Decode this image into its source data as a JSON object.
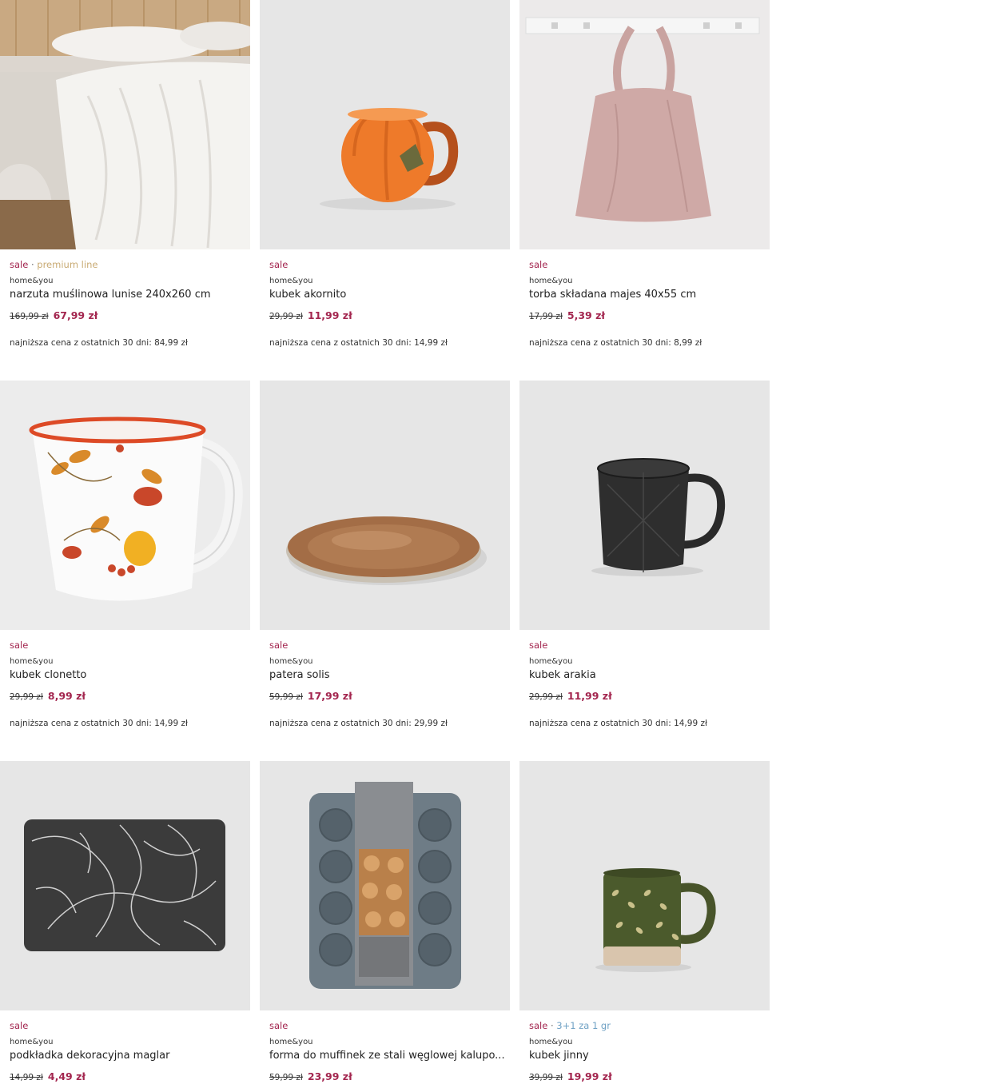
{
  "colors": {
    "sale": "#a3264f",
    "premium": "#c9ab74",
    "promo": "#6fa1c4",
    "image_bg": "#e6e6e6"
  },
  "products": [
    {
      "image": "bedspread-photo",
      "tag_sale": "sale",
      "tag_extra": "premium line",
      "tag_extra_kind": "premium",
      "brand": "home&you",
      "name": "narzuta muślinowa lunise 240x260 cm",
      "old_price": "169,99 zł",
      "new_price": "67,99 zł",
      "lowest": "najniższa cena z ostatnich 30 dni: 84,99 zł"
    },
    {
      "image": "pumpkin-mug-photo",
      "tag_sale": "sale",
      "tag_extra": "",
      "tag_extra_kind": "",
      "brand": "home&you",
      "name": "kubek akornito",
      "old_price": "29,99 zł",
      "new_price": "11,99 zł",
      "lowest": "najniższa cena z ostatnich 30 dni: 14,99 zł"
    },
    {
      "image": "tote-bag-photo",
      "tag_sale": "sale",
      "tag_extra": "",
      "tag_extra_kind": "",
      "brand": "home&you",
      "name": "torba składana majes 40x55 cm",
      "old_price": "17,99 zł",
      "new_price": "5,39 zł",
      "lowest": "najniższa cena z ostatnich 30 dni: 8,99 zł"
    },
    {
      "image": "autumn-mug-photo",
      "tag_sale": "sale",
      "tag_extra": "",
      "tag_extra_kind": "",
      "brand": "home&you",
      "name": "kubek clonetto",
      "old_price": "29,99 zł",
      "new_price": "8,99 zł",
      "lowest": "najniższa cena z ostatnich 30 dni: 14,99 zł"
    },
    {
      "image": "gold-plate-photo",
      "tag_sale": "sale",
      "tag_extra": "",
      "tag_extra_kind": "",
      "brand": "home&you",
      "name": "patera solis",
      "old_price": "59,99 zł",
      "new_price": "17,99 zł",
      "lowest": "najniższa cena z ostatnich 30 dni: 29,99 zł"
    },
    {
      "image": "black-mug-photo",
      "tag_sale": "sale",
      "tag_extra": "",
      "tag_extra_kind": "",
      "brand": "home&you",
      "name": "kubek arakia",
      "old_price": "29,99 zł",
      "new_price": "11,99 zł",
      "lowest": "najniższa cena z ostatnich 30 dni: 14,99 zł"
    },
    {
      "image": "placemat-photo",
      "tag_sale": "sale",
      "tag_extra": "",
      "tag_extra_kind": "",
      "brand": "home&you",
      "name": "podkładka dekoracyjna maglar",
      "old_price": "14,99 zł",
      "new_price": "4,49 zł",
      "lowest": ""
    },
    {
      "image": "muffin-tray-photo",
      "tag_sale": "sale",
      "tag_extra": "",
      "tag_extra_kind": "",
      "brand": "home&you",
      "name": "forma do muffinek ze stali węglowej kalupo...",
      "old_price": "59,99 zł",
      "new_price": "23,99 zł",
      "lowest": ""
    },
    {
      "image": "green-mug-photo",
      "tag_sale": "sale",
      "tag_extra": "3+1 za 1 gr",
      "tag_extra_kind": "promo",
      "brand": "home&you",
      "name": "kubek jinny",
      "old_price": "39,99 zł",
      "new_price": "19,99 zł",
      "lowest": ""
    }
  ]
}
